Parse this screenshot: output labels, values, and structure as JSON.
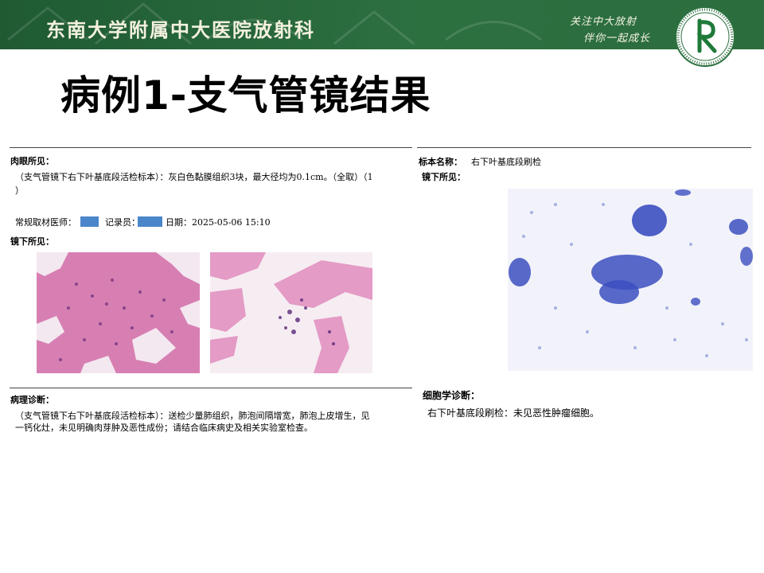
{
  "header": {
    "hospital": "东南大学附属中大医院放射科",
    "slogan_line1": "关注中大放射",
    "slogan_line2": "伴你一起成长"
  },
  "slide": {
    "title": "病例1-支气管镜结果"
  },
  "left_report": {
    "gross_label": "肉眼所见：",
    "gross_text_line1": "（支气管镜下右下叶基底段活检标本）：灰白色黏膜组织3块，最大径均为0.1cm。（全取）（1",
    "gross_text_line2": "）",
    "sampler_label": "常规取材医师：",
    "recorder_label": "记录员：",
    "date_label": "日期：2025-05-06 15:10",
    "micro_label": "镜下所见：",
    "diagnosis_label": "病理诊断：",
    "diagnosis_line1": "（支气管镜下右下叶基底段活检标本）：送检少量肺组织，肺泡间隔增宽，肺泡上皮增生，见",
    "diagnosis_line2": "一钙化灶，未见明确肉芽肿及恶性成份；请结合临床病史及相关实验室检查。"
  },
  "right_report": {
    "specimen_label": "标本名称：",
    "specimen_value": "右下叶基底段刷检",
    "micro_label": "镜下所见：",
    "cyto_label": "细胞学诊断：",
    "cyto_text": "右下叶基底段刷检：未见恶性肿瘤细胞。"
  },
  "colors": {
    "header_green": "#2a6b3c",
    "redaction_blue": "#4a86c9",
    "he_stain": "#d98ab8",
    "pap_stain": "#3c4fc0"
  }
}
